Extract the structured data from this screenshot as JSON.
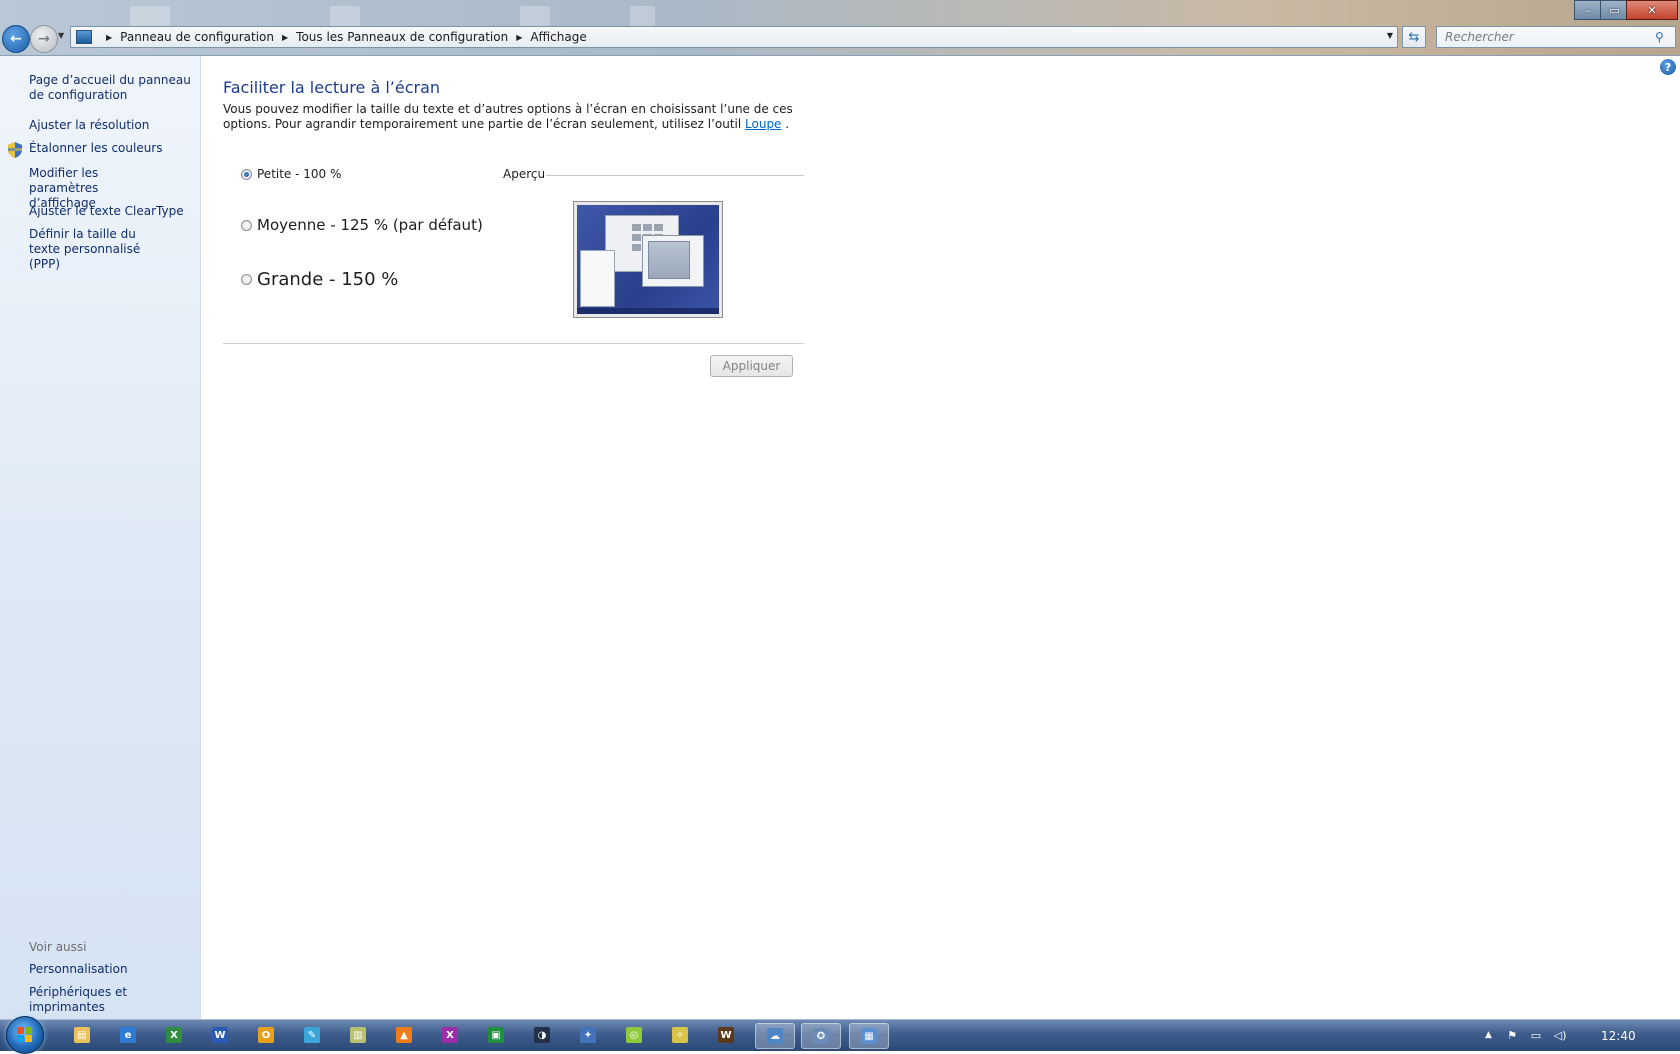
{
  "window": {
    "minimize_glyph": "–",
    "maximize_glyph": "▭",
    "close_glyph": "✕"
  },
  "address_bar": {
    "breadcrumbs": [
      "Panneau de configuration",
      "Tous les Panneaux de configuration",
      "Affichage"
    ],
    "search_placeholder": "Rechercher"
  },
  "sidebar": {
    "home_link": "Page d’accueil du panneau de configuration",
    "links": [
      "Ajuster la résolution",
      "Étalonner les couleurs",
      "Modifier les paramètres d’affichage",
      "Ajuster le texte ClearType",
      "Définir la taille du texte personnalisé (PPP)"
    ],
    "see_also_heading": "Voir aussi",
    "see_also_links": [
      "Personnalisation",
      "Périphériques et imprimantes"
    ]
  },
  "main": {
    "title": "Faciliter la lecture à l’écran",
    "intro_text": "Vous pouvez modifier la taille du texte et d’autres options à l’écran en choisissant l’une de ces options. Pour agrandir temporairement une partie de l’écran seulement, utilisez l’outil ",
    "intro_link": "Loupe",
    "intro_end": " .",
    "options": [
      {
        "label": "Petite - 100 %",
        "selected": true
      },
      {
        "label": "Moyenne - 125 % (par défaut)",
        "selected": false
      },
      {
        "label": "Grande - 150 %",
        "selected": false
      }
    ],
    "preview_label": "Aperçu",
    "apply_button": "Appliquer"
  },
  "taskbar": {
    "apps": [
      "explorer",
      "internet-explorer",
      "excel",
      "word",
      "outlook",
      "app",
      "notepad",
      "vlc",
      "xmind",
      "terminal",
      "app",
      "network",
      "app",
      "app",
      "warcraft",
      "control-panel",
      "app",
      "display"
    ],
    "app_glyphs": [
      "▤",
      "e",
      "X",
      "W",
      "O",
      "✎",
      "▥",
      "▲",
      "X",
      "▣",
      "◑",
      "✦",
      "◎",
      "✧",
      "W",
      "☁",
      "✪",
      "▦"
    ],
    "clock": "12:40"
  },
  "colors": {
    "link": "#0f2e6d",
    "title": "#1e3d8f",
    "taskbar": "#3d5c8b"
  }
}
